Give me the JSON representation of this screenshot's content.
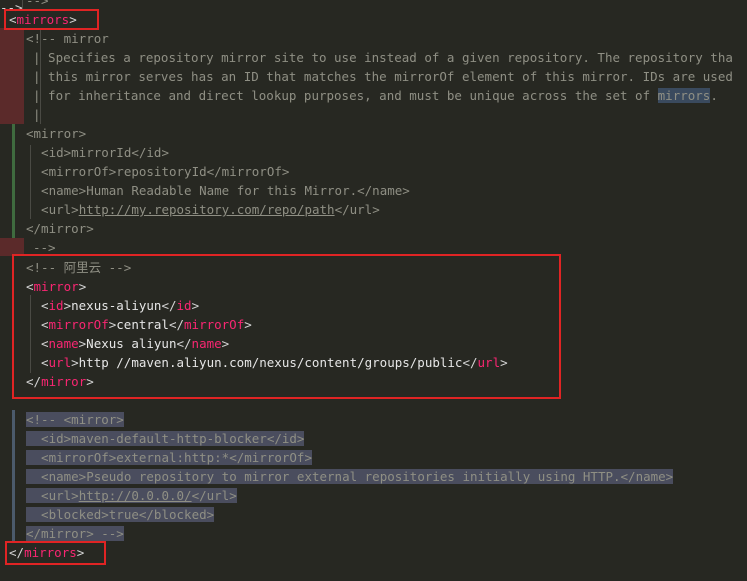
{
  "top_fragment": "-->",
  "mirrors_open": "mirrors",
  "comment_block": {
    "open": "<!-- mirror",
    "lines": [
      "| Specifies a repository mirror site to use instead of a given repository. The repository tha",
      "| this mirror serves has an ID that matches the mirrorOf element of this mirror. IDs are used",
      "| for inheritance and direct lookup purposes, and must be unique across the set of "
    ],
    "last_word": "mirrors",
    "last_punct": ".",
    "empty_bar": "|",
    "example": {
      "mirror_open": "<mirror>",
      "id": "  <id>mirrorId</id>",
      "mirrorOf": "  <mirrorOf>repositoryId</mirrorOf>",
      "name": "  <name>Human Readable Name for this Mirror.</name>",
      "url_prefix": "  <url>",
      "url_value": "http://my.repository.com/repo/path",
      "url_suffix": "</url>",
      "mirror_close": "</mirror>"
    },
    "close": "-->"
  },
  "aliyun": {
    "comment": "<!-- 阿里云 -->",
    "mirror_tag": "mirror",
    "id_tag": "id",
    "id_value": "nexus-aliyun",
    "mirrorOf_tag": "mirrorOf",
    "mirrorOf_value": "central",
    "name_tag": "name",
    "name_value": "Nexus aliyun",
    "url_tag": "url",
    "url_value": "http //maven.aliyun.com/nexus/content/groups/public"
  },
  "blocker": {
    "open": "<!-- <mirror>",
    "id": "  <id>maven-default-http-blocker</id>",
    "mirrorOf": "  <mirrorOf>external:http:*</mirrorOf>",
    "name": "  <name>Pseudo repository to mirror external repositories initially using HTTP.</name>",
    "url_prefix": "  <url>",
    "url_value": "http://0.0.0.0/",
    "url_suffix": "</url>",
    "blocked": "  <blocked>true</blocked>",
    "close": "</mirror> -->"
  },
  "mirrors_close": "mirrors"
}
